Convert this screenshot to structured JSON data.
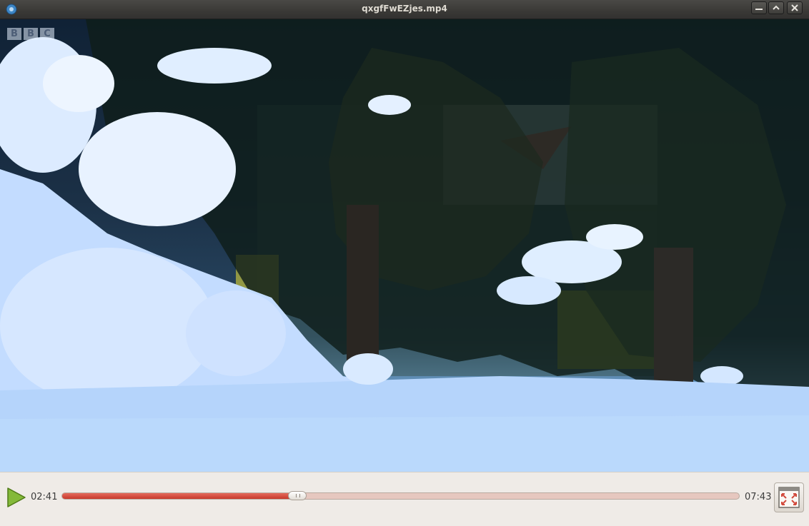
{
  "window": {
    "title": "qxgfFwEZjes.mp4",
    "app_icon": "media-player-icon",
    "buttons": [
      "minimize-icon",
      "maximize-icon",
      "close-icon"
    ]
  },
  "video": {
    "watermark": [
      "B",
      "B",
      "C"
    ]
  },
  "player": {
    "elapsed": "02:41",
    "duration": "07:43",
    "progress_fraction": 0.348,
    "play_icon": "play-icon",
    "fullscreen_icon": "fullscreen-icon",
    "accent_color": "#d9483b"
  }
}
